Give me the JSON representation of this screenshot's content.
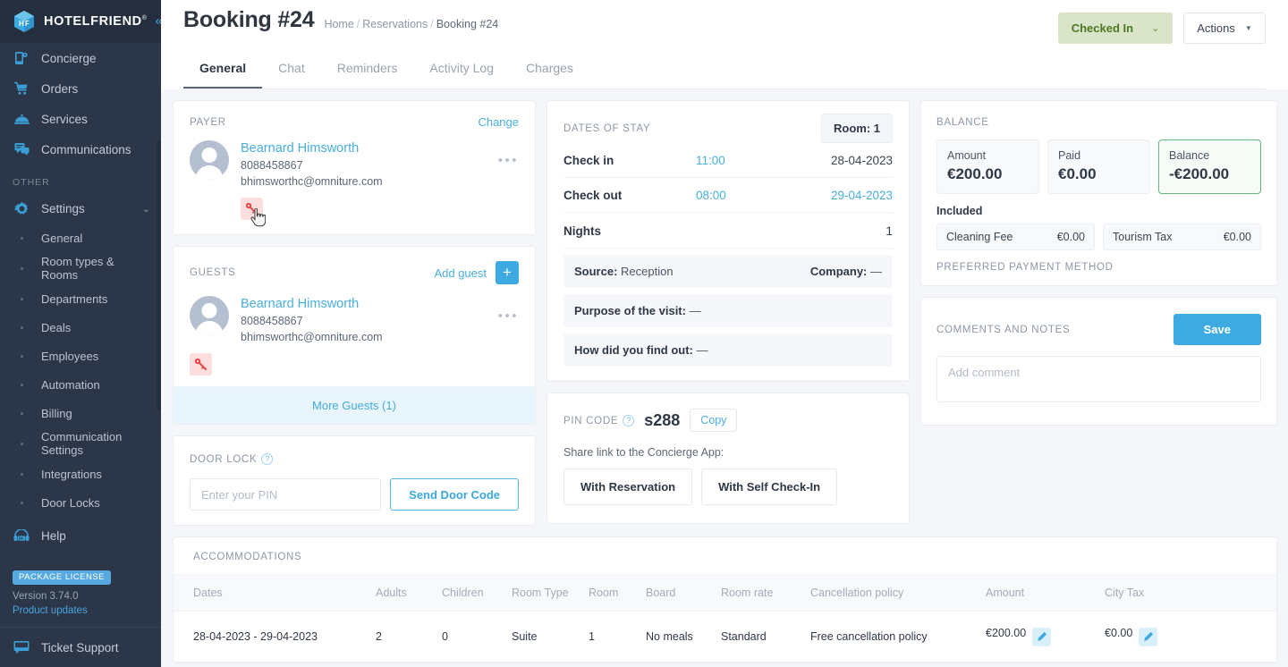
{
  "brand": {
    "name": "HOTELFRIEND",
    "registered": "®",
    "collapse_icon": "chevron-double-left-icon"
  },
  "sidebar": {
    "items": [
      {
        "label": "Concierge",
        "icon": "concierge-mobile-icon"
      },
      {
        "label": "Orders",
        "icon": "cart-icon"
      },
      {
        "label": "Services",
        "icon": "room-service-dome-icon"
      },
      {
        "label": "Communications",
        "icon": "chat-bubbles-icon"
      }
    ],
    "section_label": "OTHER",
    "settings": {
      "label": "Settings",
      "icon": "gear-icon",
      "chevron": "∨"
    },
    "sub_items": [
      {
        "label": "General"
      },
      {
        "label": "Room types & Rooms"
      },
      {
        "label": "Departments"
      },
      {
        "label": "Deals"
      },
      {
        "label": "Employees"
      },
      {
        "label": "Automation"
      },
      {
        "label": "Billing"
      },
      {
        "label": "Communication Settings"
      },
      {
        "label": "Integrations"
      },
      {
        "label": "Door Locks"
      }
    ],
    "help": {
      "label": "Help",
      "icon": "headset-24-icon"
    },
    "license_badge": "PACKAGE LICENSE",
    "version": "Version 3.74.0",
    "product_updates": "Product updates",
    "ticket_support": {
      "label": "Ticket Support",
      "icon": "chat-window-icon"
    }
  },
  "header": {
    "title": "Booking #24",
    "breadcrumb": {
      "home": "Home",
      "reservations": "Reservations",
      "current": "Booking #24",
      "separator": "/"
    },
    "status_button": {
      "label": "Checked In",
      "chevron": "∨"
    },
    "actions_button": {
      "label": "Actions",
      "chevron": "▼"
    }
  },
  "tabs": [
    {
      "label": "General",
      "active": true
    },
    {
      "label": "Chat",
      "active": false
    },
    {
      "label": "Reminders",
      "active": false
    },
    {
      "label": "Activity Log",
      "active": false
    },
    {
      "label": "Charges",
      "active": false
    }
  ],
  "payer": {
    "label": "PAYER",
    "change_link": "Change",
    "name": "Bearnard Himsworth",
    "phone": "8088458867",
    "email": "bhimsworthc@omniture.com",
    "menu_icon": "ellipsis-icon",
    "key_icon": "key-icon",
    "cursor_icon": "pointer-hand-cursor"
  },
  "guests": {
    "label": "GUESTS",
    "add_link": "Add guest",
    "add_button": "+",
    "name": "Bearnard Himsworth",
    "phone": "8088458867",
    "email": "bhimsworthc@omniture.com",
    "menu_icon": "ellipsis-icon",
    "key_icon": "key-icon",
    "more_guests": "More Guests (1)"
  },
  "door_lock": {
    "label": "DOOR LOCK",
    "help_icon": "question-mark-icon",
    "pin_placeholder": "Enter your PIN",
    "pin_value": "",
    "send_button": "Send Door Code"
  },
  "dates_of_stay": {
    "label": "DATES OF STAY",
    "room_pill": "Room: 1",
    "rows": [
      {
        "label": "Check in",
        "time": "11:00",
        "date": "28-04-2023",
        "date_blue": false
      },
      {
        "label": "Check out",
        "time": "08:00",
        "date": "29-04-2023",
        "date_blue": true
      }
    ],
    "nights_label": "Nights",
    "nights_value": "1",
    "source_label": "Source:",
    "source_value": "Reception",
    "company_label": "Company:",
    "company_value": "—",
    "purpose_label": "Purpose of the visit:",
    "purpose_value": "—",
    "find_out_label": "How did you find out:",
    "find_out_value": "—"
  },
  "pin_code": {
    "label": "PIN CODE",
    "help_icon": "question-mark-icon",
    "code": "s288",
    "copy_button": "Copy",
    "share_label": "Share link to the Concierge App:",
    "with_reservation": "With Reservation",
    "with_self_checkin": "With Self Check-In"
  },
  "balance": {
    "label": "BALANCE",
    "boxes": [
      {
        "title": "Amount",
        "value": "€200.00",
        "highlight": false
      },
      {
        "title": "Paid",
        "value": "€0.00",
        "highlight": false
      },
      {
        "title": "Balance",
        "value": "-€200.00",
        "highlight": true
      }
    ],
    "included_label": "Included",
    "included": [
      {
        "name": "Cleaning Fee",
        "amount": "€0.00"
      },
      {
        "name": "Tourism Tax",
        "amount": "€0.00"
      }
    ],
    "preferred_payment_method": "PREFERRED PAYMENT METHOD"
  },
  "comments": {
    "label": "COMMENTS AND NOTES",
    "save_button": "Save",
    "placeholder": "Add comment",
    "value": ""
  },
  "accommodations": {
    "label": "ACCOMMODATIONS",
    "columns": [
      "Dates",
      "Adults",
      "Children",
      "Room Type",
      "Room",
      "Board",
      "Room rate",
      "Cancellation policy",
      "Amount",
      "City Tax"
    ],
    "rows": [
      {
        "dates": "28-04-2023 - 29-04-2023",
        "adults": "2",
        "children": "0",
        "room_type": "Suite",
        "room": "1",
        "board": "No meals",
        "room_rate": "Standard",
        "cancellation_policy": "Free cancellation policy",
        "amount": "€200.00",
        "city_tax": "€0.00",
        "edit_icon": "pencil-icon"
      }
    ]
  },
  "colors": {
    "sidebar_bg": "#2b3648",
    "accent_blue": "#3eaae2",
    "link_blue": "#49aee0",
    "status_green_bg": "#d9e4c8",
    "status_green_text": "#4e7822",
    "balance_border_green": "#63b77f",
    "key_red": "#e8484c",
    "page_bg": "#f4f6f9"
  }
}
